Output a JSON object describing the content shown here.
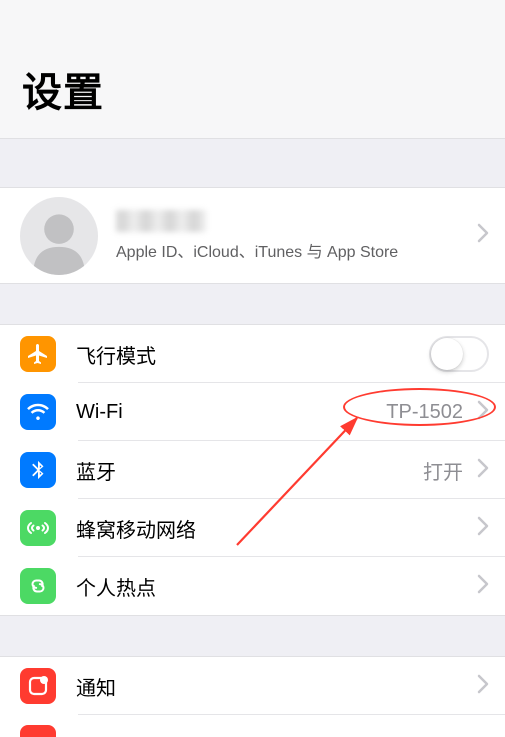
{
  "header": {
    "title": "设置"
  },
  "profile": {
    "subtitle": "Apple ID、iCloud、iTunes 与 App Store"
  },
  "rows": {
    "airplane": {
      "label": "飞行模式"
    },
    "wifi": {
      "label": "Wi-Fi",
      "value": "TP-1502"
    },
    "bluetooth": {
      "label": "蓝牙",
      "value": "打开"
    },
    "cellular": {
      "label": "蜂窝移动网络"
    },
    "hotspot": {
      "label": "个人热点"
    },
    "notifications": {
      "label": "通知"
    }
  }
}
